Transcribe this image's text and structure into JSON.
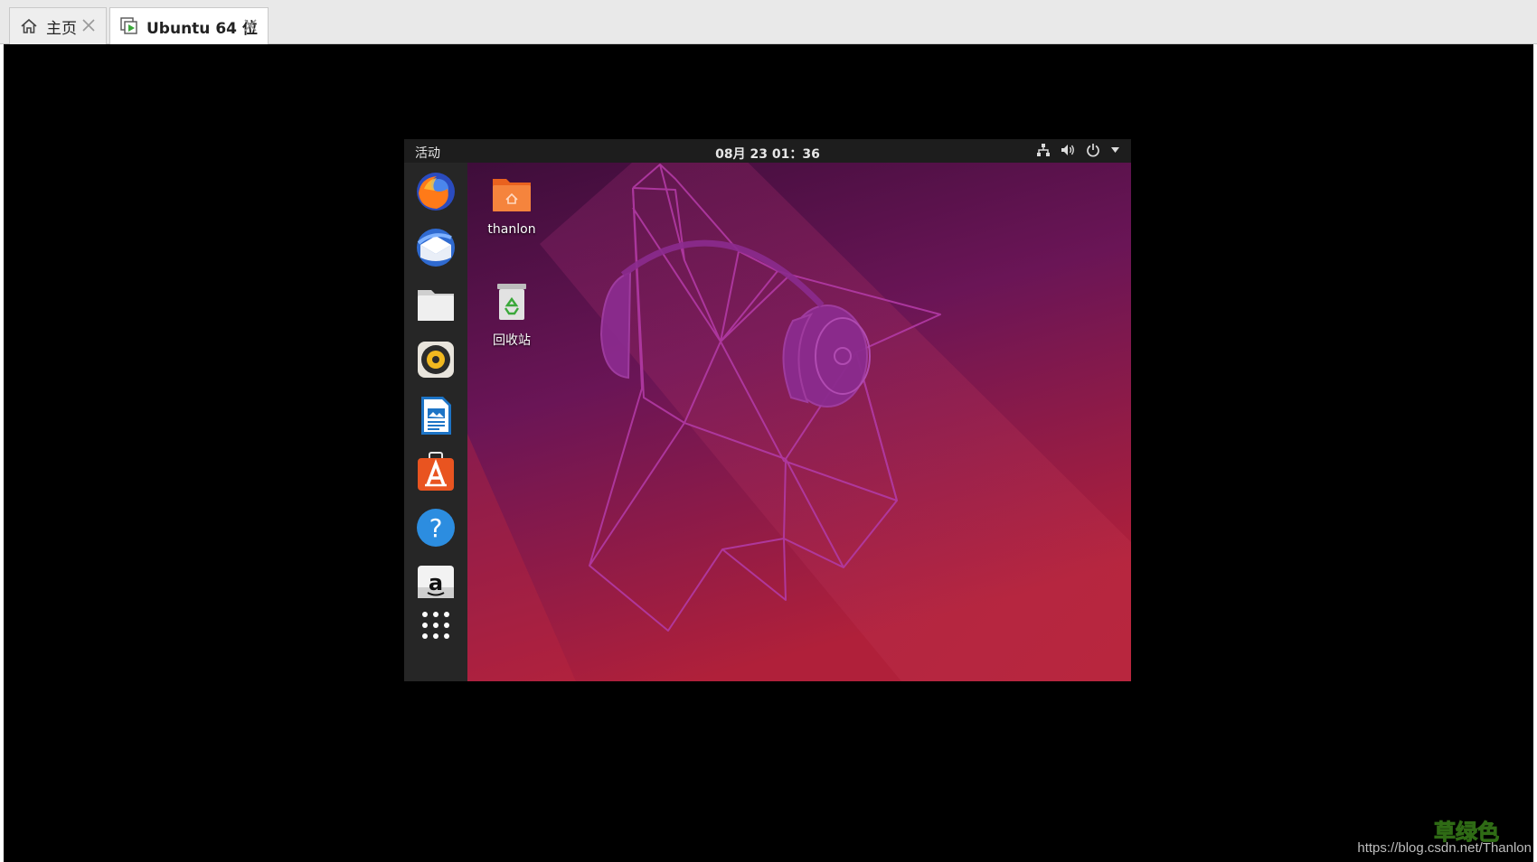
{
  "tabs": [
    {
      "label": "主页",
      "icon": "home-icon",
      "active": false
    },
    {
      "label": "Ubuntu 64 位",
      "icon": "vm-icon",
      "active": true
    }
  ],
  "guest": {
    "topbar": {
      "activities": "活动",
      "clock": "08月 23  01：36",
      "tray": [
        "network-icon",
        "volume-icon",
        "power-icon",
        "chevron-down-icon"
      ]
    },
    "dock": [
      "firefox-icon",
      "thunderbird-icon",
      "files-icon",
      "rhythmbox-icon",
      "libreoffice-writer-icon",
      "software-center-icon",
      "help-icon",
      "amazon-icon",
      "show-applications-icon"
    ],
    "desktop": [
      {
        "label": "thanlon",
        "icon": "home-folder-icon"
      },
      {
        "label": "回收站",
        "icon": "trash-icon"
      }
    ]
  },
  "watermark": {
    "url": "https://blog.csdn.net/Thanlon",
    "logo_text": "草绿色"
  },
  "colors": {
    "accent_orange": "#e95420",
    "wallpaper_top": "#4a1040",
    "wallpaper_bottom": "#b3213a"
  }
}
